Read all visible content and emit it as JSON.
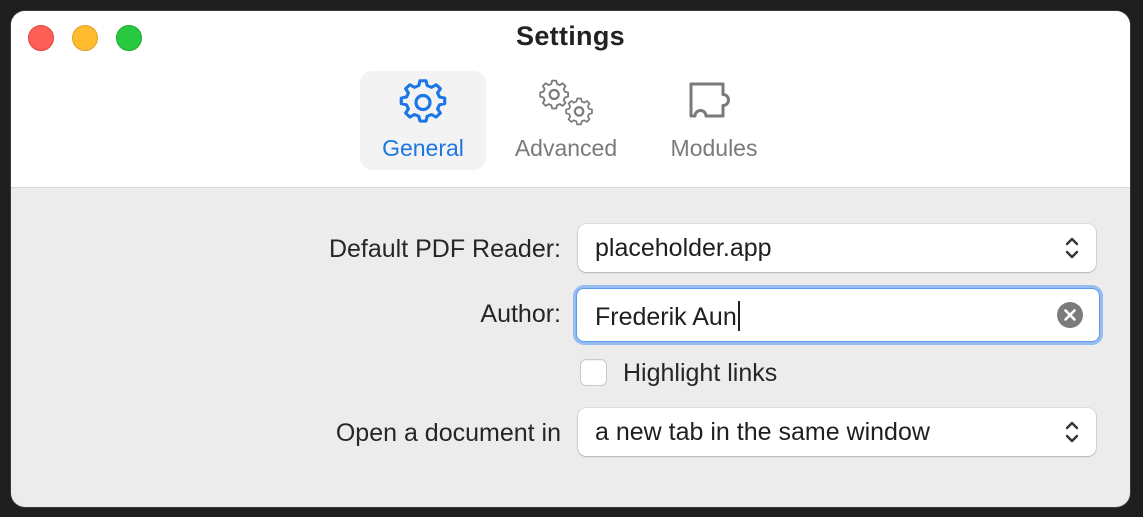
{
  "window": {
    "title": "Settings"
  },
  "tabs": [
    {
      "label": "General",
      "icon": "gear-icon",
      "selected": true
    },
    {
      "label": "Advanced",
      "icon": "gears-icon",
      "selected": false
    },
    {
      "label": "Modules",
      "icon": "puzzle-piece-icon",
      "selected": false
    }
  ],
  "form": {
    "pdf_reader": {
      "label": "Default PDF Reader:",
      "value": "placeholder.app"
    },
    "author": {
      "label": "Author:",
      "value": "Frederik Aun"
    },
    "highlight_links": {
      "label": "Highlight links",
      "checked": false
    },
    "open_document": {
      "label": "Open a document in",
      "value": "a new tab in the same window"
    }
  },
  "colors": {
    "accent": "#1d76e5",
    "close": "#fe5f57",
    "minimize": "#febc2e",
    "zoom": "#28c840"
  }
}
